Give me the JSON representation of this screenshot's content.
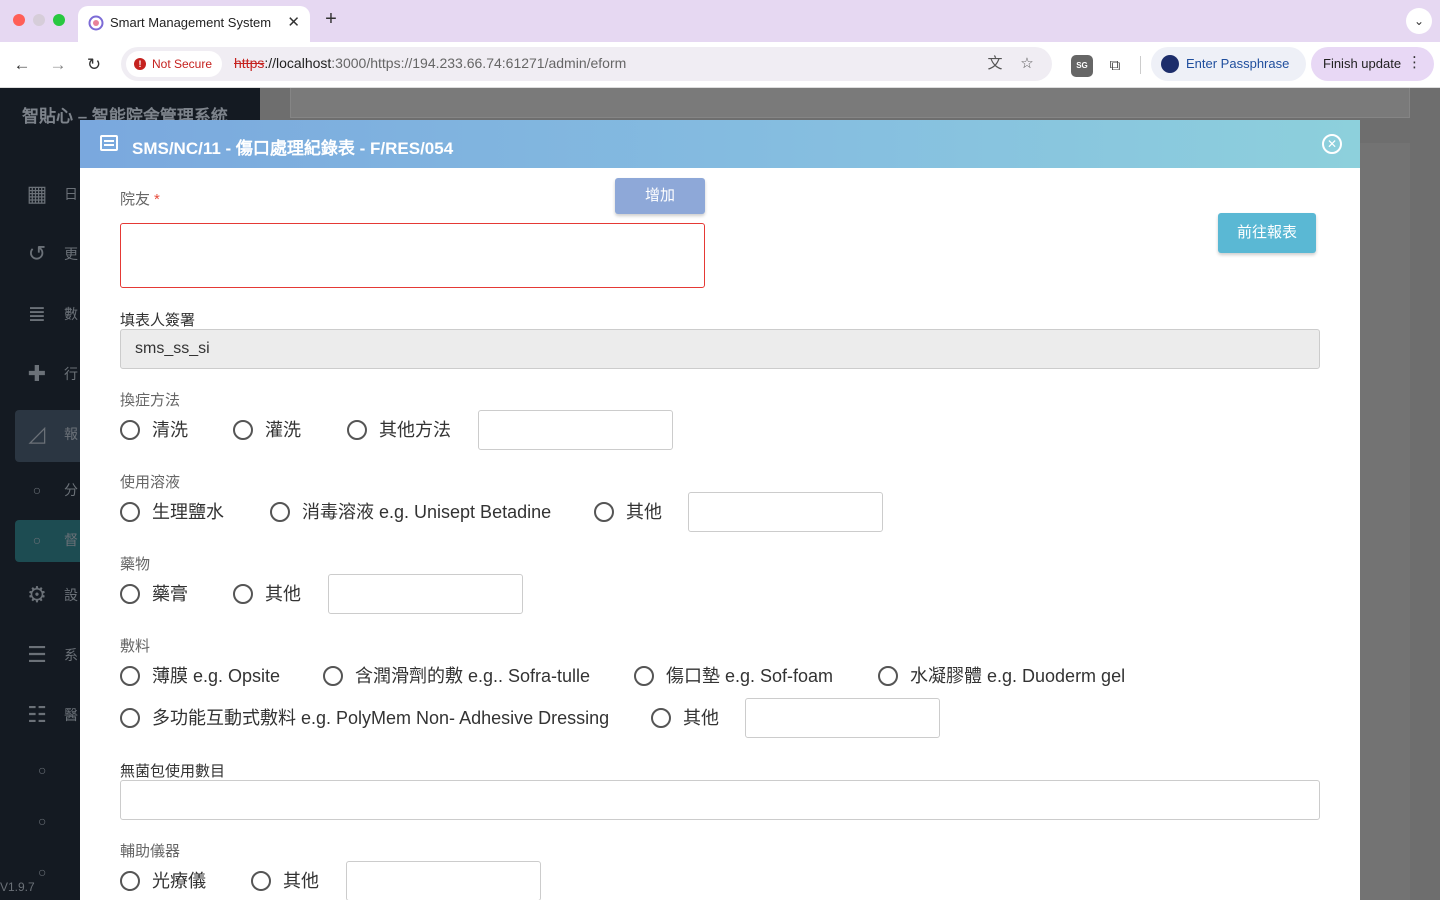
{
  "browser": {
    "tab_title": "Smart Management System",
    "tab_close": "✕",
    "new_tab": "+",
    "url_scheme": "https",
    "url_host": "://localhost",
    "url_rest": ":3000/https://194.233.66.74:61271/admin/eform",
    "security_label": "Not Secure",
    "passphrase_label": "Enter Passphrase",
    "finish_update_label": "Finish update",
    "extension_badge": "SG"
  },
  "sidebar": {
    "title": "智貼心 – 智能院舍管理系統",
    "items": [
      {
        "label": "日",
        "icon": "calendar-icon"
      },
      {
        "label": "更",
        "icon": "history-icon"
      },
      {
        "label": "數",
        "icon": "database-icon"
      },
      {
        "label": "行",
        "icon": "medical-kit-icon"
      },
      {
        "label": "報",
        "icon": "chart-icon"
      },
      {
        "label": "分",
        "icon": "circle-icon"
      },
      {
        "label": "督",
        "icon": "circle-icon"
      },
      {
        "label": "設",
        "icon": "gear-icon"
      },
      {
        "label": "系",
        "icon": "sliders-icon"
      },
      {
        "label": "醫",
        "icon": "list-icon"
      }
    ],
    "version": "V1.9.7"
  },
  "modal": {
    "title": "SMS/NC/11 - 傷口處理紀錄表 - F/RES/054",
    "close_icon": "✕",
    "resident_label": "院友",
    "required_mark": "*",
    "add_button": "增加",
    "report_button": "前往報表",
    "signature_label": "填表人簽署",
    "signature_value": "sms_ss_si",
    "dressing_method": {
      "label": "換症方法",
      "options": [
        "清洗",
        "灌洗",
        "其他方法"
      ]
    },
    "solution": {
      "label": "使用溶液",
      "options": [
        "生理鹽水",
        "消毒溶液 e.g. Unisept Betadine",
        "其他"
      ]
    },
    "medication": {
      "label": "藥物",
      "options": [
        "藥膏",
        "其他"
      ]
    },
    "dressing": {
      "label": "敷料",
      "options": [
        "薄膜 e.g. Opsite",
        "含潤滑劑的敷 e.g.. Sofra-tulle",
        "傷口墊 e.g. Sof-foam",
        "水凝膠體 e.g. Duoderm gel",
        "多功能互動式敷料 e.g. PolyMem Non- Adhesive Dressing",
        "其他"
      ]
    },
    "sterile_pack": {
      "label": "無菌包使用數目"
    },
    "device": {
      "label": "輔助儀器",
      "options": [
        "光療儀",
        "其他"
      ]
    }
  }
}
